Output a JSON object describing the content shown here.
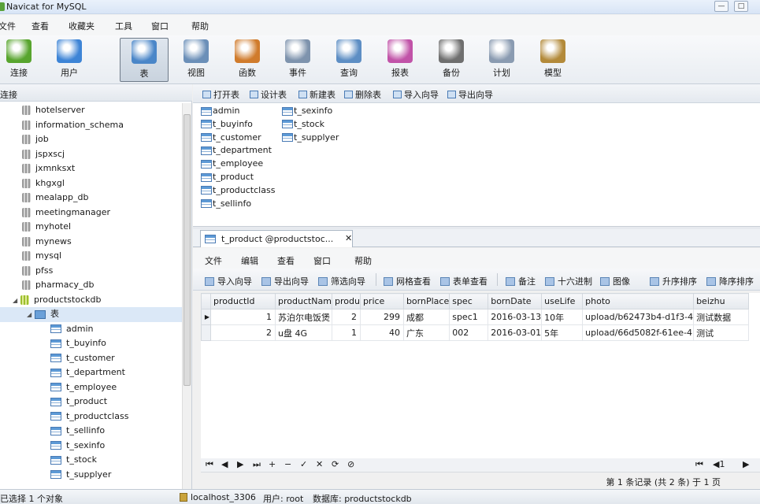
{
  "window": {
    "title": "Navicat for MySQL",
    "btn_min": "—",
    "btn_max": "□"
  },
  "menubar": [
    "文件",
    "查看",
    "收藏夹",
    "工具",
    "窗口",
    "帮助"
  ],
  "toolbar": [
    {
      "label": "连接",
      "icon": "connection-icon",
      "color": "#58a52e"
    },
    {
      "label": "用户",
      "icon": "user-icon",
      "color": "#3d84d6"
    },
    {
      "label": "表",
      "icon": "table-icon",
      "color": "#4a86c8"
    },
    {
      "label": "视图",
      "icon": "view-icon",
      "color": "#6b8fb8"
    },
    {
      "label": "函数",
      "icon": "function-icon",
      "color": "#d07b2c"
    },
    {
      "label": "事件",
      "icon": "event-icon",
      "color": "#7e93ad"
    },
    {
      "label": "查询",
      "icon": "query-icon",
      "color": "#5d8ec4"
    },
    {
      "label": "报表",
      "icon": "report-icon",
      "color": "#c153a8"
    },
    {
      "label": "备份",
      "icon": "backup-icon",
      "color": "#6f6f6f"
    },
    {
      "label": "计划",
      "icon": "schedule-icon",
      "color": "#8a9bb1"
    },
    {
      "label": "模型",
      "icon": "model-icon",
      "color": "#b38a3a"
    }
  ],
  "left_pane": {
    "header": "连接"
  },
  "tree": {
    "databases": [
      "hotelserver",
      "information_schema",
      "job",
      "jspxscj",
      "jxmnksxt",
      "khgxgl",
      "mealapp_db",
      "meetingmanager",
      "myhotel",
      "mynews",
      "mysql",
      "pfss",
      "pharmacy_db",
      "productstockdb"
    ],
    "tables_folder": "表",
    "tables": [
      "admin",
      "t_buyinfo",
      "t_customer",
      "t_department",
      "t_employee",
      "t_product",
      "t_productclass",
      "t_sellinfo",
      "t_sexinfo",
      "t_stock",
      "t_supplyer"
    ]
  },
  "object_toolbar": [
    "打开表",
    "设计表",
    "新建表",
    "删除表",
    "导入向导",
    "导出向导"
  ],
  "object_list": [
    "admin",
    "t_buyinfo",
    "t_customer",
    "t_department",
    "t_employee",
    "t_product",
    "t_productclass",
    "t_sellinfo",
    "t_sexinfo",
    "t_stock",
    "t_supplyer"
  ],
  "tab": {
    "title": "t_product @productstoc...",
    "close": "✕"
  },
  "inner_menu": [
    "文件",
    "编辑",
    "查看",
    "窗口",
    "帮助"
  ],
  "inner_toolbar": [
    "导入向导",
    "导出向导",
    "筛选向导",
    "网格查看",
    "表单查看",
    "备注",
    "十六进制",
    "图像",
    "升序排序",
    "降序排序"
  ],
  "grid": {
    "columns": [
      "productId",
      "productNam",
      "produ",
      "price",
      "bornPlace",
      "spec",
      "bornDate",
      "useLife",
      "photo",
      "beizhu"
    ],
    "rows": [
      [
        "1",
        "苏泊尔电饭煲",
        "2",
        "299",
        "成都",
        "spec1",
        "2016-03-13",
        "10年",
        "upload/b62473b4-d1f3-4",
        "测试数据"
      ],
      [
        "2",
        "u盘 4G",
        "1",
        "40",
        "广东",
        "002",
        "2016-03-01",
        "5年",
        "upload/66d5082f-61ee-4",
        "测试"
      ]
    ]
  },
  "navbar": [
    "⏮",
    "◀",
    "▶",
    "⏭",
    "+",
    "−",
    "✓",
    "✕",
    "⟳",
    "⊘"
  ],
  "navbar_right": [
    "⏮",
    "◀1",
    "▶"
  ],
  "pager_text": "第 1 条记录 (共 2 条) 于 1 页",
  "status": {
    "left": "已选择 1 个对象",
    "server": "localhost_3306",
    "user": "用户: root",
    "database": "数据库: productstockdb"
  }
}
